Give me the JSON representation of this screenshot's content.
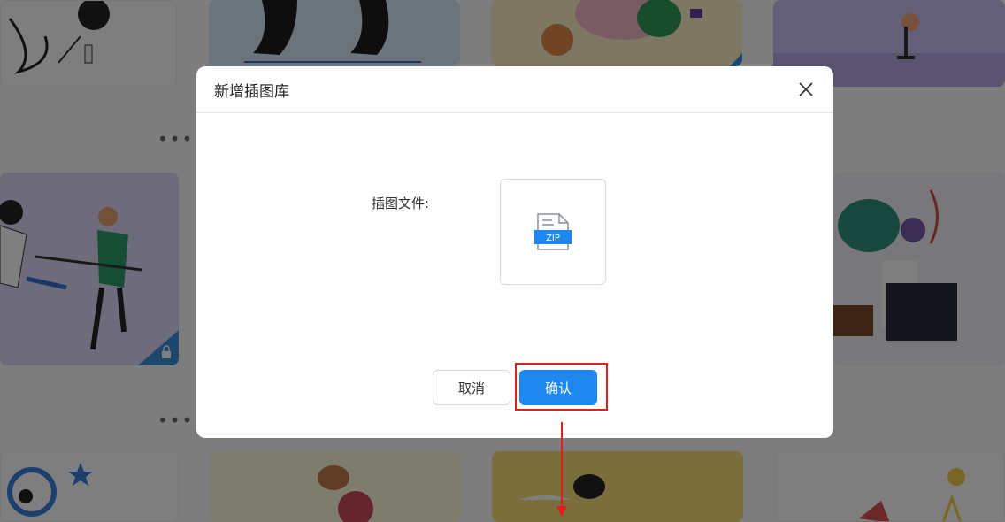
{
  "dialog": {
    "title": "新增插图库",
    "field_label": "插图文件:",
    "file_badge": "ZIP",
    "cancel_label": "取消",
    "confirm_label": "确认"
  },
  "gallery": {
    "more_label": "•••"
  },
  "colors": {
    "primary": "#1e87f0",
    "highlight": "#e0201b"
  }
}
